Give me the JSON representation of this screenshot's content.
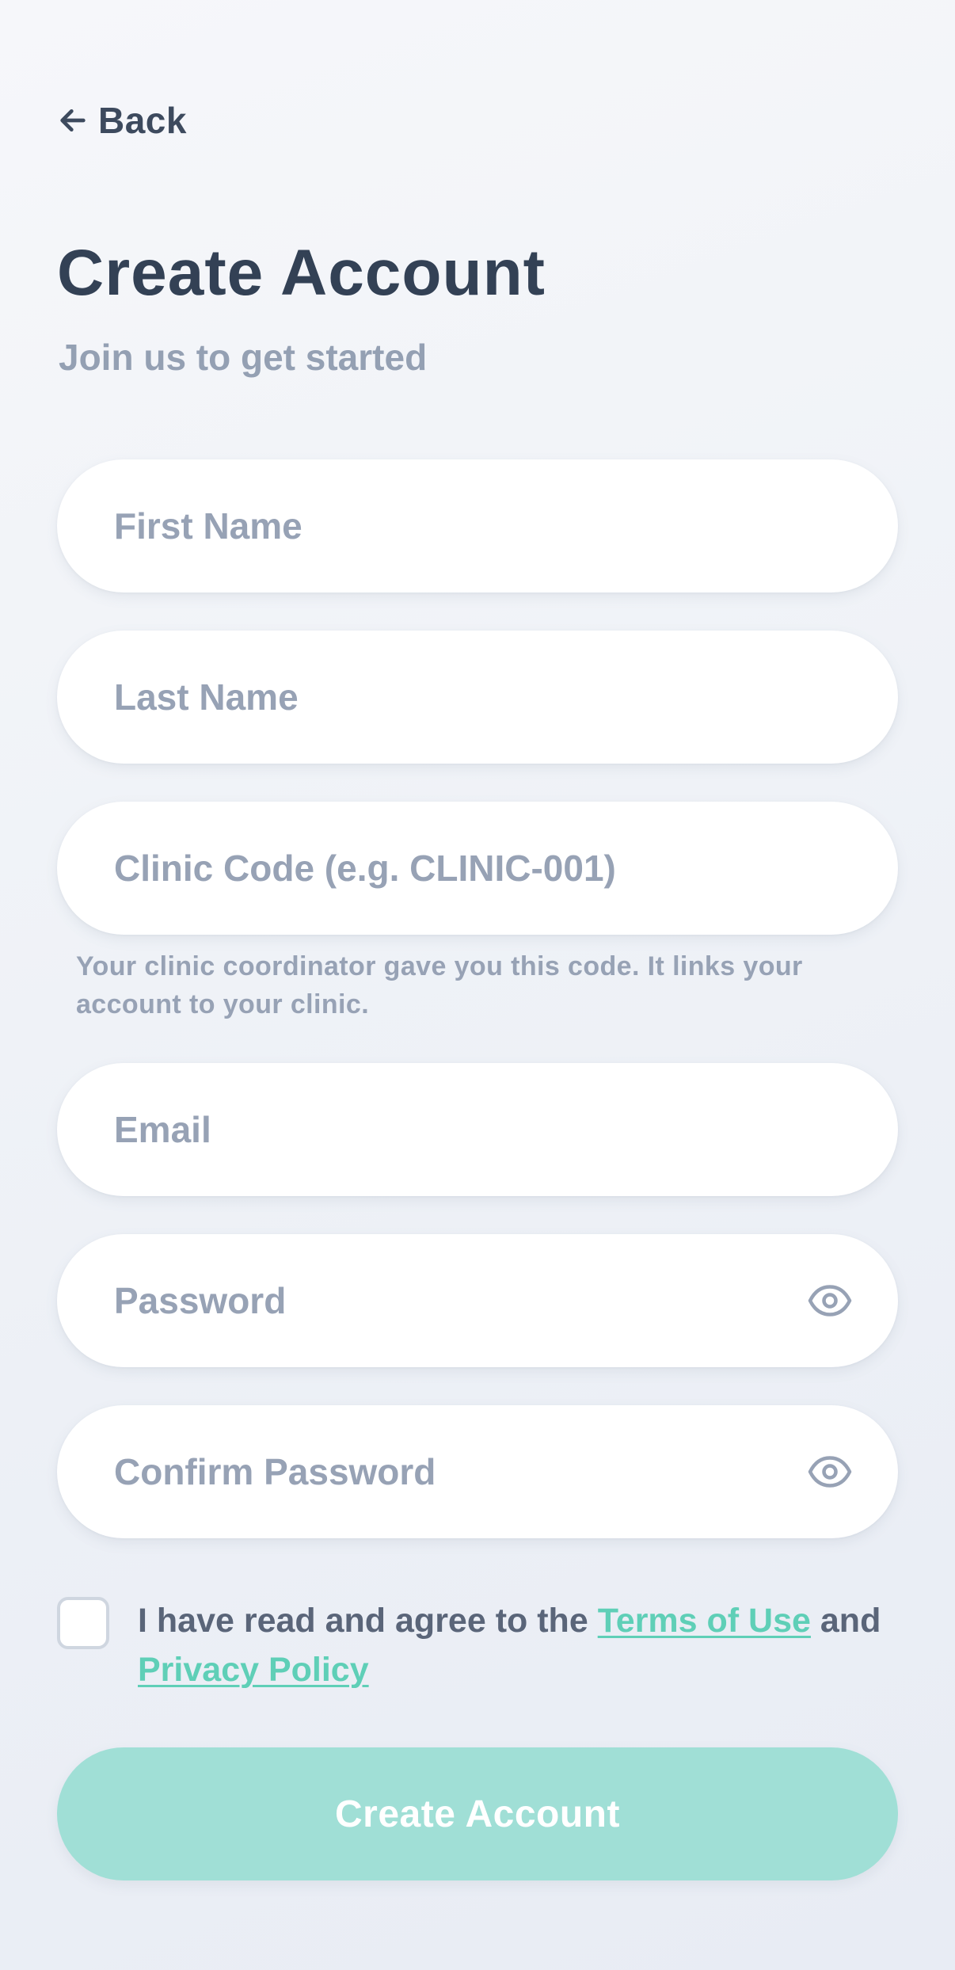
{
  "header": {
    "back_label": "Back",
    "back_icon": "arrow-left-icon",
    "title": "Create Account",
    "subtitle": "Join us to get started"
  },
  "form": {
    "first_name": {
      "placeholder": "First Name",
      "value": ""
    },
    "last_name": {
      "placeholder": "Last Name",
      "value": ""
    },
    "clinic_code": {
      "placeholder": "Clinic Code (e.g. CLINIC-001)",
      "value": "",
      "helper": "Your clinic coordinator gave you this code. It links your account to your clinic."
    },
    "email": {
      "placeholder": "Email",
      "value": ""
    },
    "password": {
      "placeholder": "Password",
      "value": "",
      "icon": "eye-icon"
    },
    "confirm_password": {
      "placeholder": "Confirm Password",
      "value": "",
      "icon": "eye-icon"
    }
  },
  "terms": {
    "checked": false,
    "prefix": "I have read and agree to the ",
    "terms_link": "Terms of Use",
    "conjunction": " and ",
    "privacy_link": "Privacy Policy"
  },
  "submit": {
    "label": "Create Account",
    "enabled": false
  },
  "colors": {
    "accent": "#5fcfb7",
    "button_disabled": "#a0dfd6",
    "title": "#334155",
    "muted": "#97a2b5",
    "background": "#eff2f7"
  }
}
